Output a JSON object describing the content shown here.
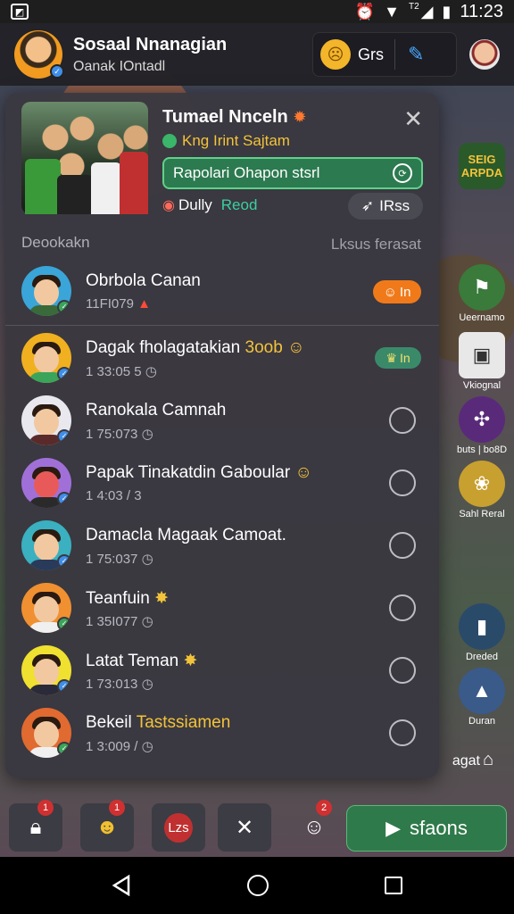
{
  "status_bar": {
    "time": "11:23",
    "sim": "T2"
  },
  "header": {
    "title": "Sosaal Nnanagian",
    "subtitle": "Oanak IOntadl",
    "currency_label": "Grs"
  },
  "group": {
    "name": "Tumael Nnceln",
    "status": "Kng Irint Sajtam",
    "action_text": "Rapolari Ohapon stsrl",
    "meta_left": "Dully",
    "meta_read": "Reod",
    "rss_label": "IRss",
    "section_left": "Deookakn",
    "section_right": "Lksus ferasat"
  },
  "pinned": {
    "name": "Obrbola Canan",
    "sub": "11FI079",
    "pill": "In"
  },
  "contacts": [
    {
      "name": "Dagak fholagatakian",
      "highlight": "3oob",
      "sub": "1 33:05 5",
      "pill": "In"
    },
    {
      "name": "Ranokala Camnah",
      "highlight": "",
      "sub": "1 75:073"
    },
    {
      "name": "Papak Tinakatdin Gaboular",
      "highlight": "",
      "sub": "1 4:03 / 3"
    },
    {
      "name": "Damacla Magaak Camoat.",
      "highlight": "",
      "sub": "1 75:037"
    },
    {
      "name": "Teanfuin",
      "highlight": "",
      "sub": "1 35I077"
    },
    {
      "name": "Latat Teman",
      "highlight": "",
      "sub": "1 73:013"
    },
    {
      "name": "Bekeil",
      "highlight": "Tastssiamen",
      "sub": "1 3:009 /"
    }
  ],
  "side_buttons": {
    "logo": "SEIG ARPDA",
    "b1": "Ueernamo",
    "b2": "Vkiognal",
    "b3": "buts | bo8D",
    "b4": "Sahl Reral",
    "b5": "Dreded",
    "b6": "Duran",
    "b7": "agat"
  },
  "bottom_bar": {
    "badge1": "1",
    "badge2": "1",
    "bs_label": "Lzs",
    "badge3": "2",
    "play_label": "sfaons"
  },
  "colors": {
    "accent_green": "#2c7a50",
    "accent_orange": "#f07a1a",
    "panel": "#3a3840"
  }
}
